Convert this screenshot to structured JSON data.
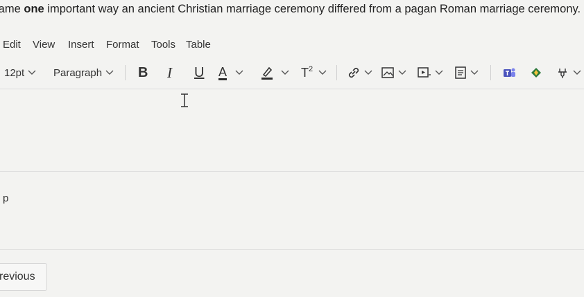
{
  "question": {
    "prefix": "lame ",
    "bold": "one",
    "suffix": " important way an ancient Christian marriage ceremony differed from a pagan Roman marriage ceremony."
  },
  "menu": [
    "Edit",
    "View",
    "Insert",
    "Format",
    "Tools",
    "Table"
  ],
  "toolbar": {
    "font_size": "12pt",
    "block_format": "Paragraph",
    "bold": "B",
    "italic": "I",
    "underline": "U",
    "text_color": "A",
    "superscript": "T",
    "superscript_mark": "2"
  },
  "status_path": "p",
  "previous_button": "revious",
  "colors": {
    "teams": "#4b53bc",
    "green_app": "#2f7a3b",
    "text_color_bar": "#2d2d2d",
    "highlight_bar": "#2d2d2d"
  },
  "icons": [
    "link-icon",
    "image-icon",
    "media-icon",
    "document-icon",
    "teams-icon",
    "google-drive-icon",
    "apps-icon"
  ]
}
